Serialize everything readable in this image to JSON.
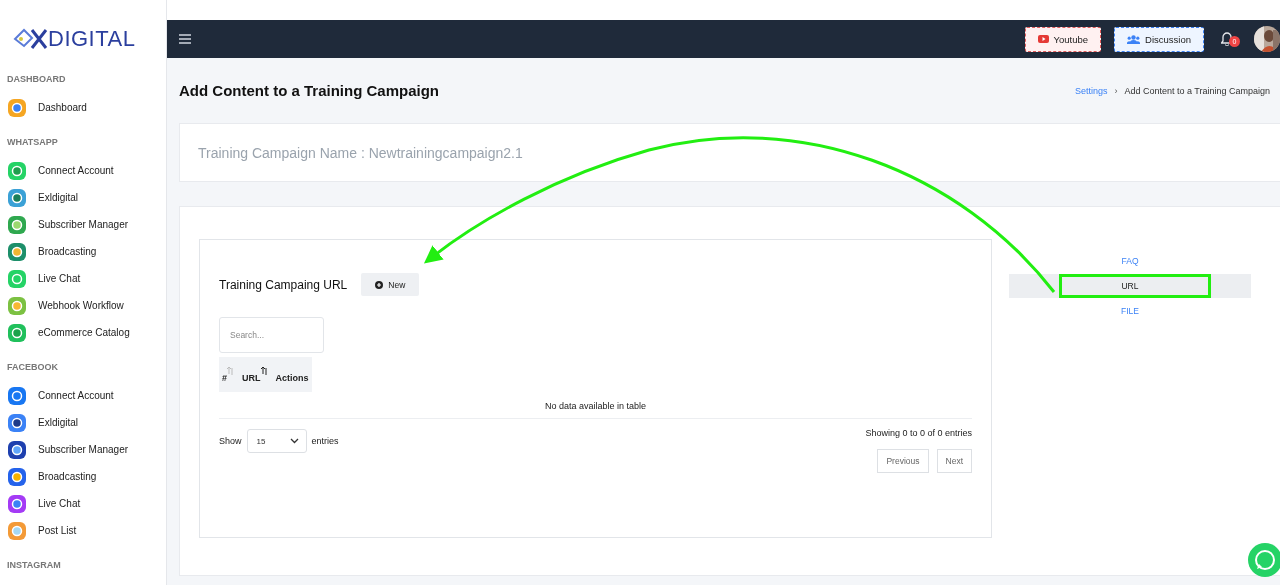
{
  "logo": {
    "text": "DIGITAL"
  },
  "sidebar": {
    "sections": [
      {
        "title": "DASHBOARD",
        "items": [
          {
            "label": "Dashboard"
          }
        ]
      },
      {
        "title": "WHATSAPP",
        "items": [
          {
            "label": "Connect Account"
          },
          {
            "label": "Exldigital"
          },
          {
            "label": "Subscriber Manager"
          },
          {
            "label": "Broadcasting"
          },
          {
            "label": "Live Chat"
          },
          {
            "label": "Webhook Workflow"
          },
          {
            "label": "eCommerce Catalog"
          }
        ]
      },
      {
        "title": "FACEBOOK",
        "items": [
          {
            "label": "Connect Account"
          },
          {
            "label": "Exldigital"
          },
          {
            "label": "Subscriber Manager"
          },
          {
            "label": "Broadcasting"
          },
          {
            "label": "Live Chat"
          },
          {
            "label": "Post List"
          }
        ]
      },
      {
        "title": "INSTAGRAM"
      }
    ]
  },
  "topbar": {
    "buttons": [
      {
        "label": "Youtube",
        "kind": "youtube"
      },
      {
        "label": "Discussion",
        "kind": "discussion"
      }
    ],
    "notification_count": "0"
  },
  "page": {
    "title": "Add Content to a Training Campaign",
    "breadcrumb_separator": "›",
    "breadcrumb": [
      {
        "label": "Settings",
        "link": true
      },
      {
        "label": "Add Content to a Training Campaign",
        "link": false
      }
    ]
  },
  "campaign_name": "Training Campaign Name : Newtrainingcampaign2.1",
  "panel": {
    "title": "Training Campaing URL",
    "new_button": "New",
    "search": {
      "placeholder": "Search..."
    },
    "table": {
      "columns": [
        "#",
        "URL",
        "Actions"
      ],
      "empty_message": "No data available in table"
    },
    "length": {
      "before": "Show",
      "value": "15",
      "after": "entries"
    },
    "info": "Showing 0 to 0 of 0 entries",
    "pagination": [
      {
        "label": "Previous"
      },
      {
        "label": "Next"
      }
    ]
  },
  "tabs": [
    {
      "label": "FAQ",
      "selected": false
    },
    {
      "label": "URL",
      "selected": true
    },
    {
      "label": "FILE",
      "selected": false
    }
  ]
}
